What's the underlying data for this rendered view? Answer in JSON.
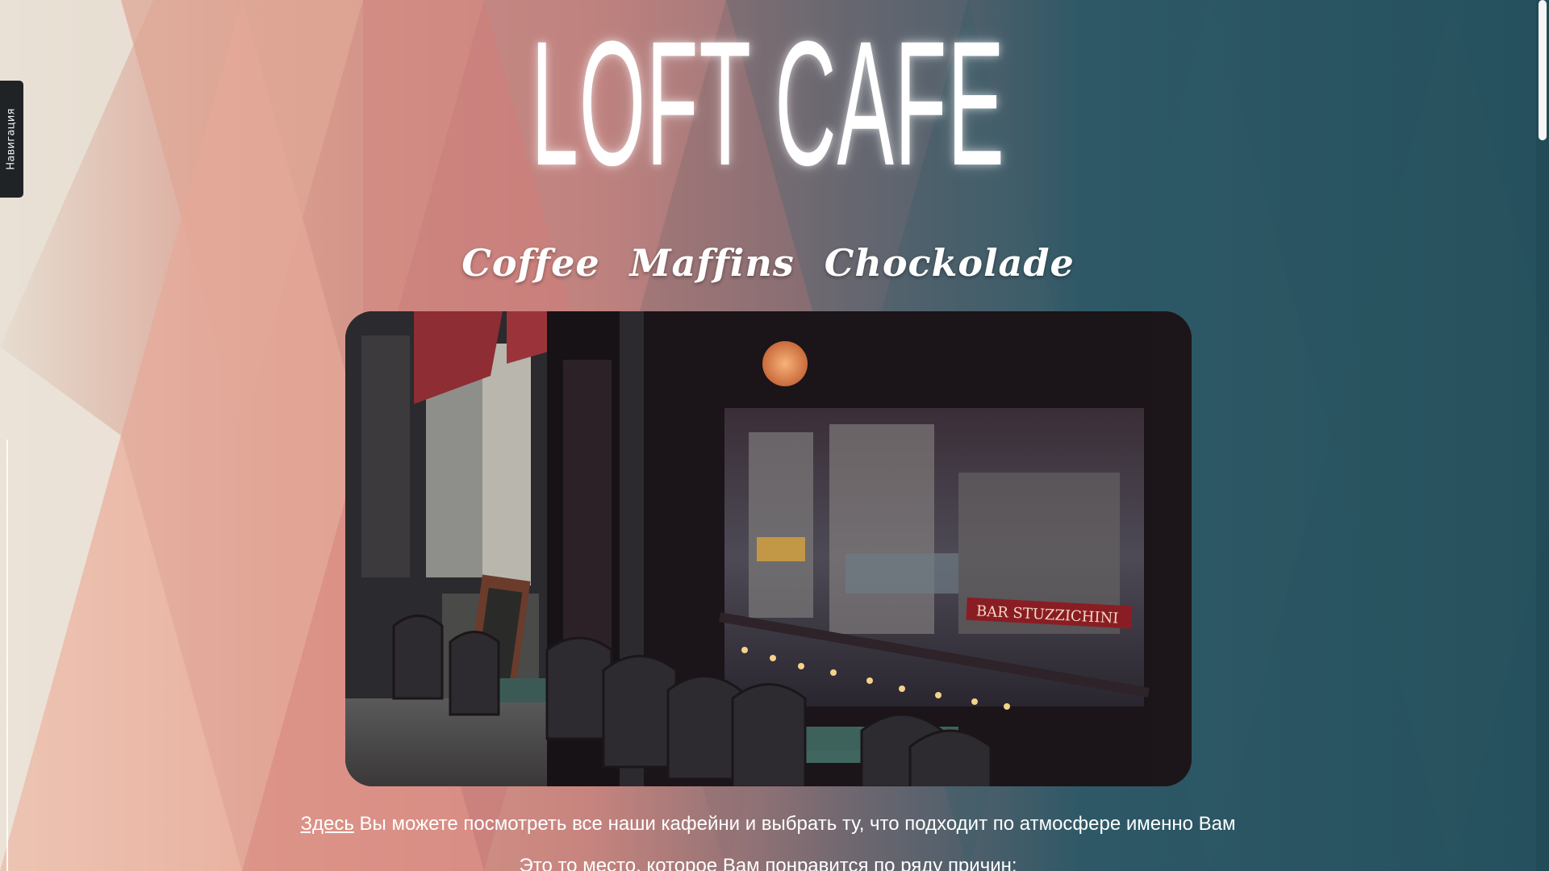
{
  "navigation": {
    "tab_label": "Навигация"
  },
  "header": {
    "logo_text": "LOFT CAFE",
    "tagline": [
      "Coffee",
      "Maffins",
      "Chockolade"
    ]
  },
  "hero": {
    "sign_text": "BAR STUZZICHINI"
  },
  "intro": {
    "link_text": "Здесь",
    "text": " Вы можете посмотреть все наши кафейни и выбрать ту, что подходит по атмосфере именно Вам",
    "second_line": "Это то место, которое Вам понравится по ряду причин:"
  },
  "colors": {
    "background_teal": "#2b5563",
    "background_rose": "#d98a80",
    "background_cream": "#e8dfd3",
    "nav_tab": "#1f2326",
    "text": "#ffffff"
  }
}
